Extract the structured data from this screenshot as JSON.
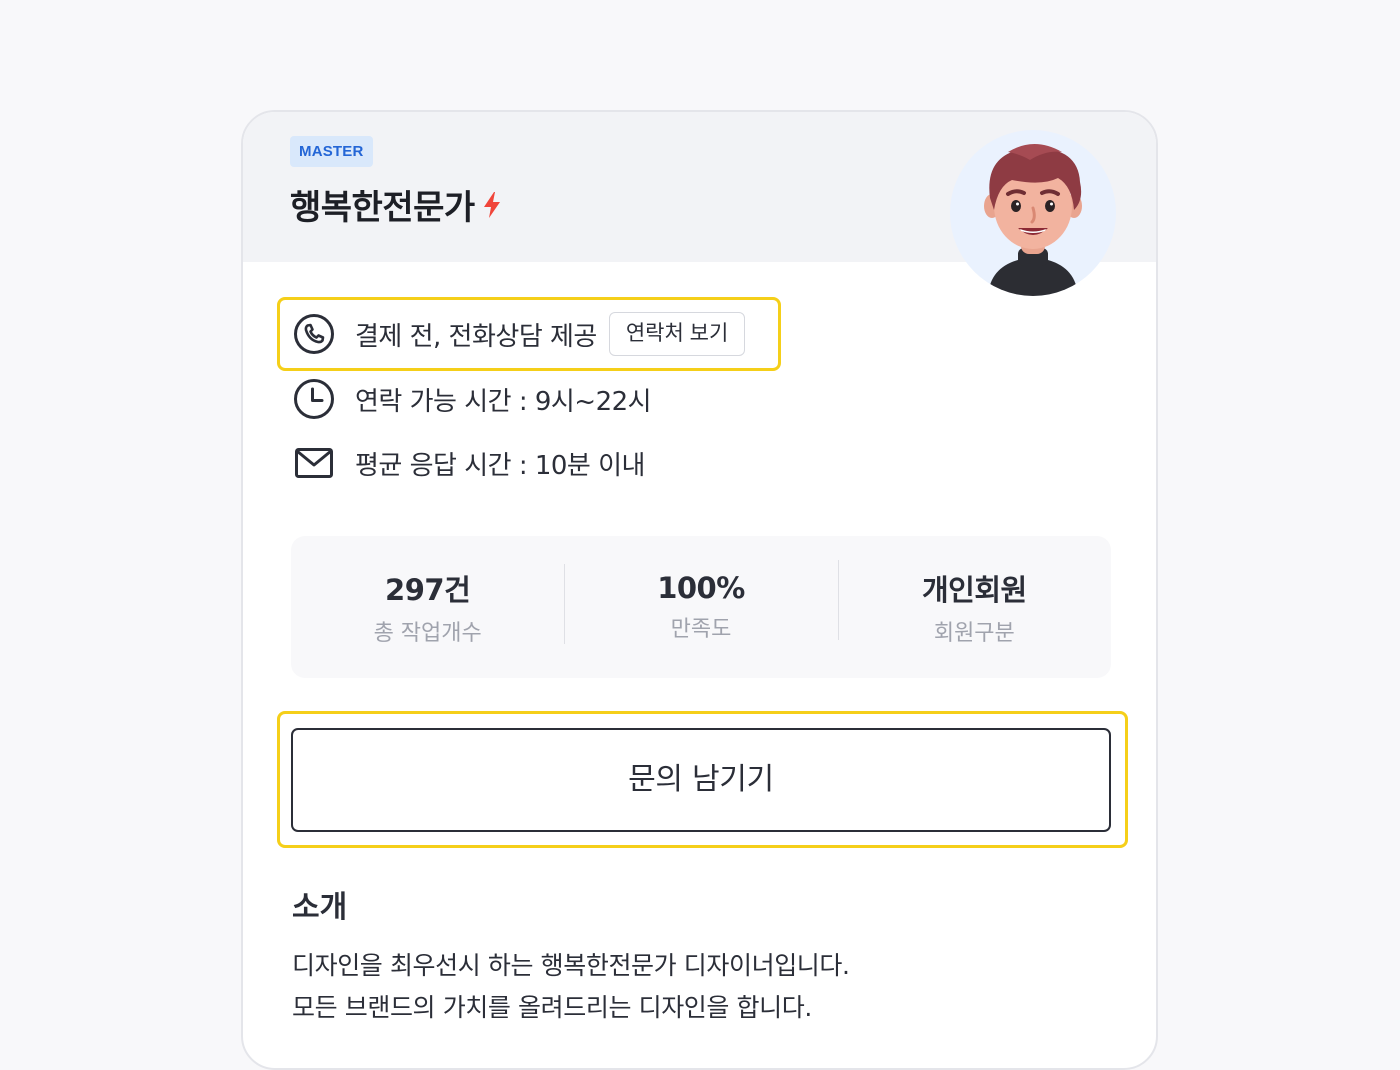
{
  "expert": {
    "badge": "MASTER",
    "name": "행복한전문가"
  },
  "info": {
    "phone_text": "결제 전, 전화상담 제공",
    "contact_button": "연락처 보기",
    "hours_text": "연락 가능 시간 : 9시~22시",
    "response_text": "평균 응답 시간 : 10분 이내"
  },
  "stats": [
    {
      "value": "297건",
      "label": "총 작업개수"
    },
    {
      "value": "100%",
      "label": "만족도"
    },
    {
      "value": "개인회원",
      "label": "회원구분"
    }
  ],
  "inquiry_button": "문의 남기기",
  "intro": {
    "title": "소개",
    "line1": "디자인을 최우선시 하는 행복한전문가 디자이너입니다.",
    "line2": "모든 브랜드의 가치를 올려드리는 디자인을 합니다."
  },
  "colors": {
    "highlight": "#f5cf19",
    "badge_bg": "#d9e8fb",
    "badge_text": "#2466d6",
    "bolt": "#f0453a"
  },
  "icons": {
    "bolt": "lightning-bolt-icon",
    "phone": "phone-icon",
    "clock": "clock-icon",
    "mail": "mail-icon",
    "avatar": "avatar-illustration"
  }
}
